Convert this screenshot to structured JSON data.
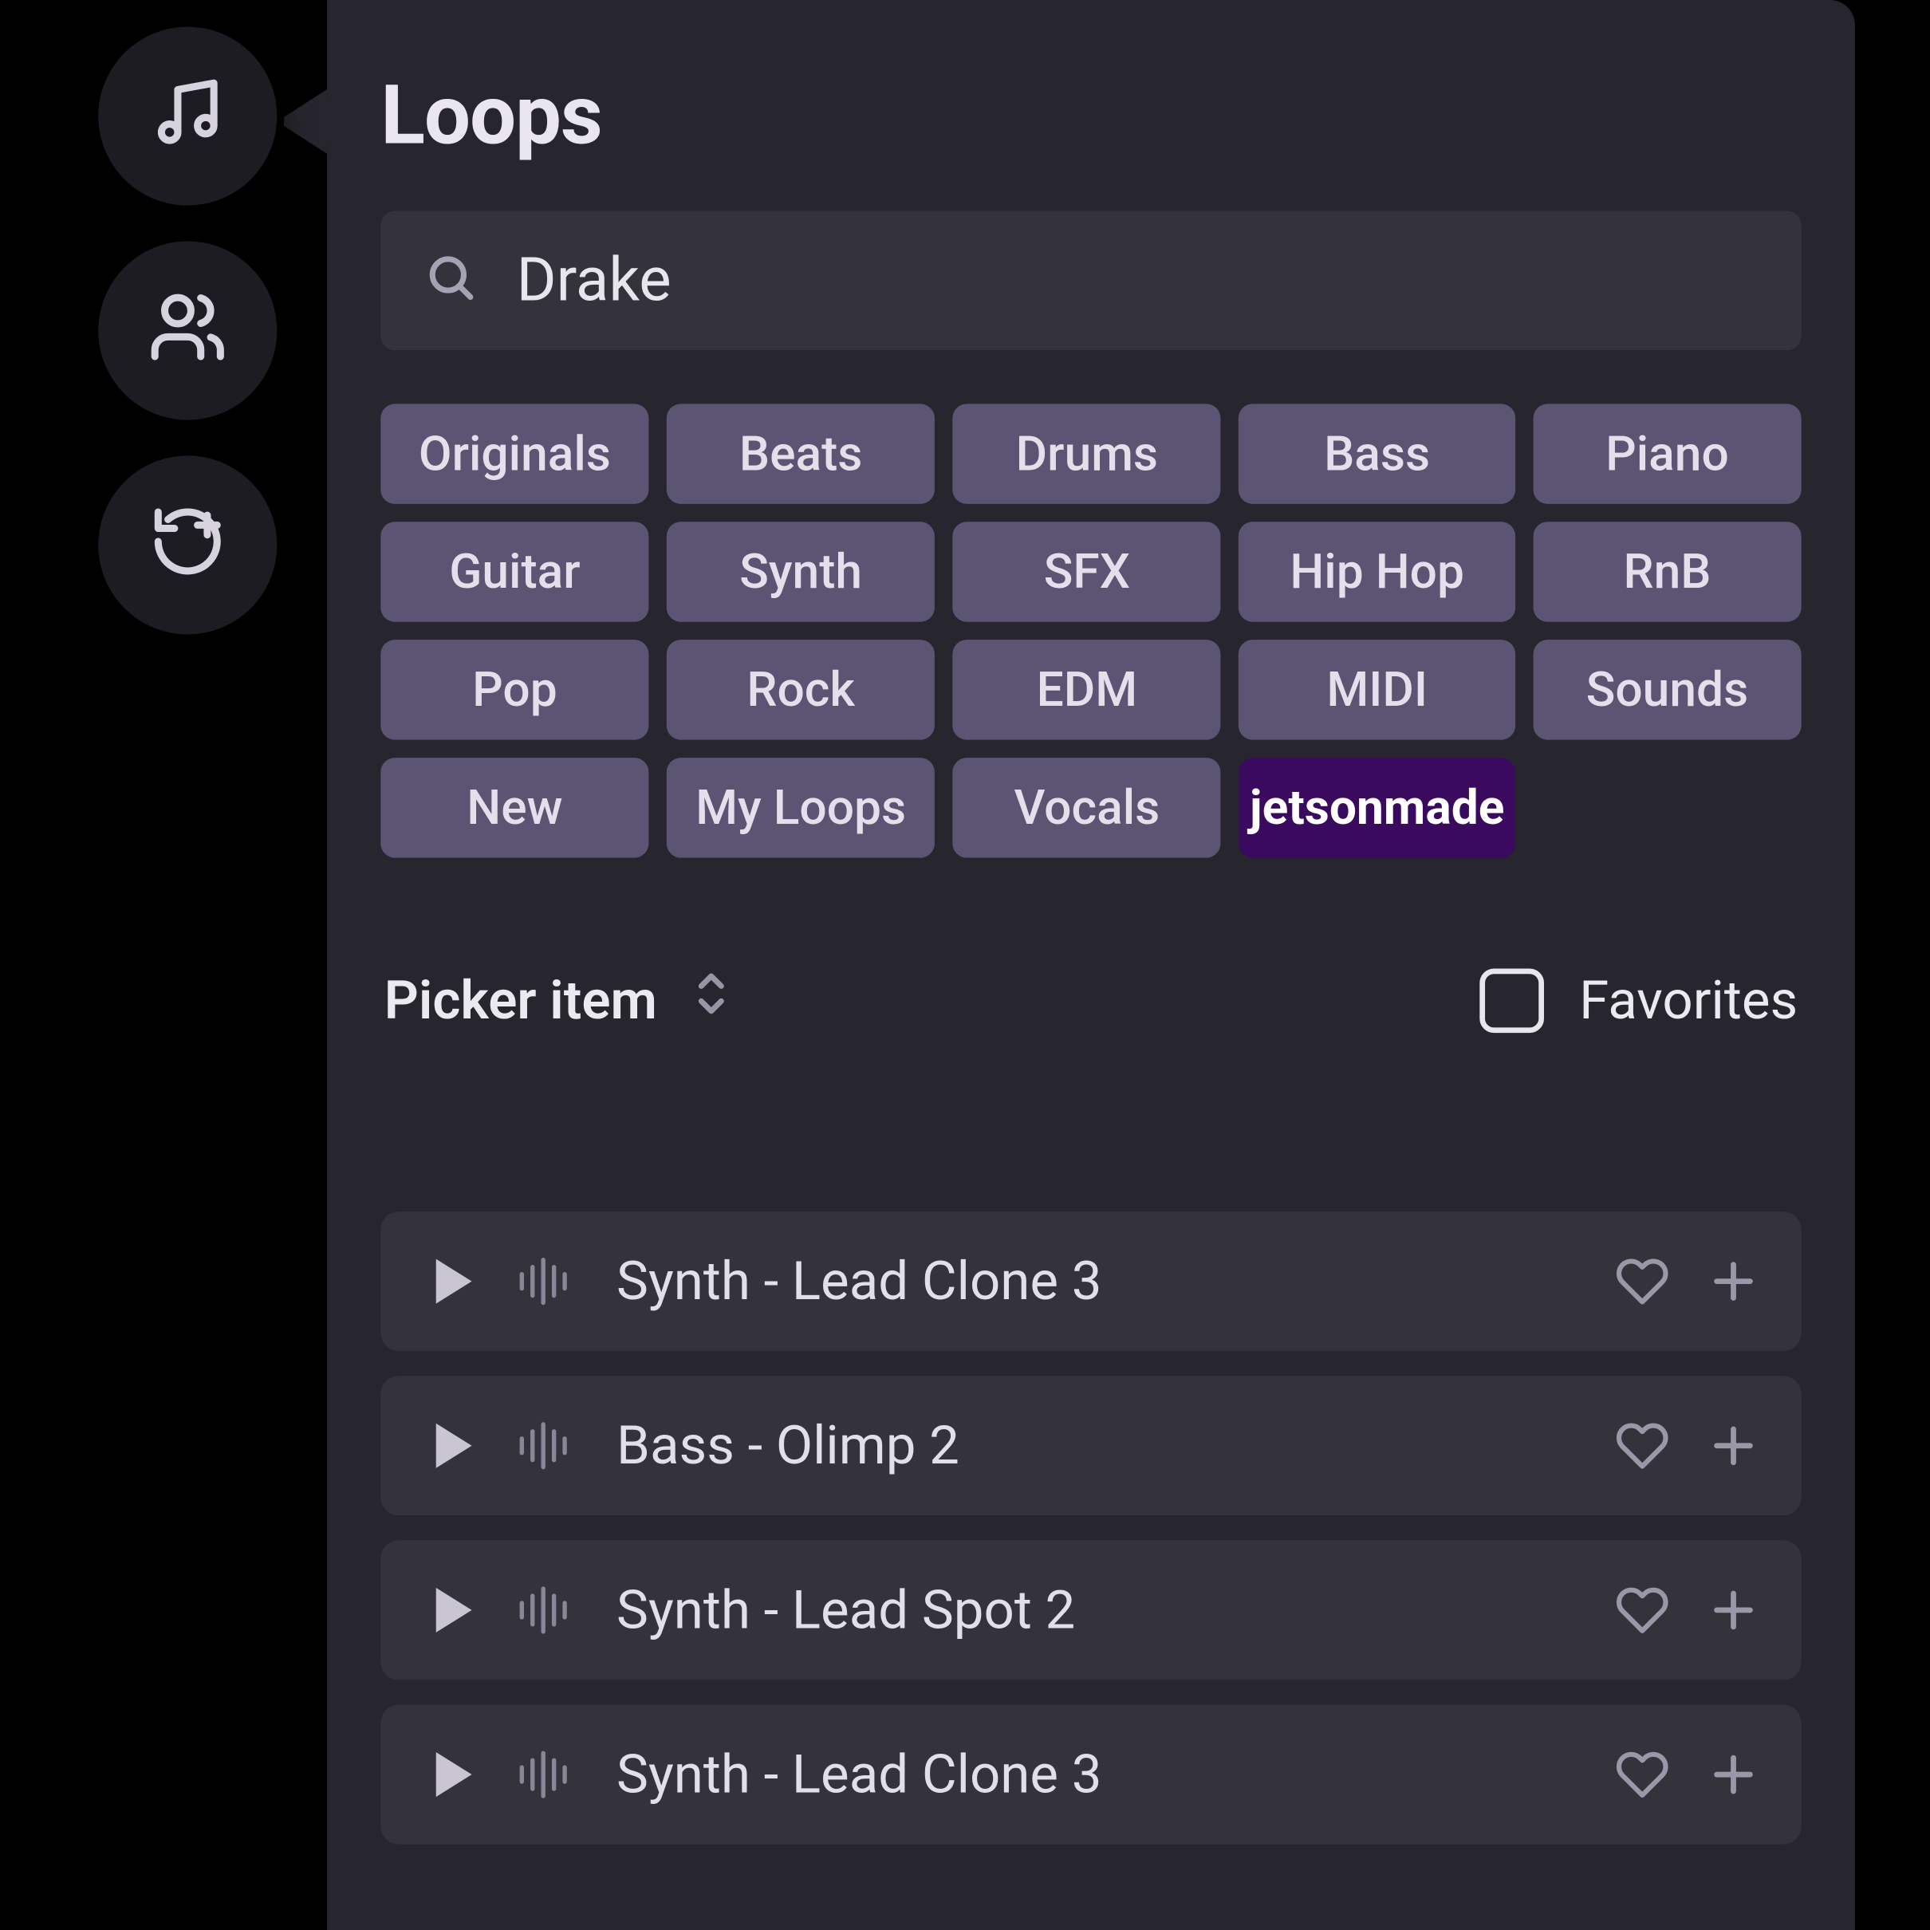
{
  "sidebar": {
    "icons": [
      "music-note-icon",
      "people-icon",
      "loop-plus-icon"
    ]
  },
  "panel": {
    "title": "Loops",
    "search": {
      "value": "Drake",
      "placeholder": "Search"
    },
    "tags": [
      {
        "label": "Originals",
        "highlight": false
      },
      {
        "label": "Beats",
        "highlight": false
      },
      {
        "label": "Drums",
        "highlight": false
      },
      {
        "label": "Bass",
        "highlight": false
      },
      {
        "label": "Piano",
        "highlight": false
      },
      {
        "label": "Guitar",
        "highlight": false
      },
      {
        "label": "Synth",
        "highlight": false
      },
      {
        "label": "SFX",
        "highlight": false
      },
      {
        "label": "Hip Hop",
        "highlight": false
      },
      {
        "label": "RnB",
        "highlight": false
      },
      {
        "label": "Pop",
        "highlight": false
      },
      {
        "label": "Rock",
        "highlight": false
      },
      {
        "label": "EDM",
        "highlight": false
      },
      {
        "label": "MIDI",
        "highlight": false
      },
      {
        "label": "Sounds",
        "highlight": false
      },
      {
        "label": "New",
        "highlight": false
      },
      {
        "label": "My Loops",
        "highlight": false
      },
      {
        "label": "Vocals",
        "highlight": false
      },
      {
        "label": "jetsonmade",
        "highlight": true
      }
    ],
    "picker": {
      "label": "Picker item"
    },
    "favorites": {
      "label": "Favorites",
      "checked": false
    },
    "tracks": [
      {
        "name": "Synth - Lead Clone 3"
      },
      {
        "name": "Bass - Olimp 2"
      },
      {
        "name": "Synth - Lead Spot 2"
      },
      {
        "name": "Synth - Lead Clone 3"
      }
    ]
  }
}
